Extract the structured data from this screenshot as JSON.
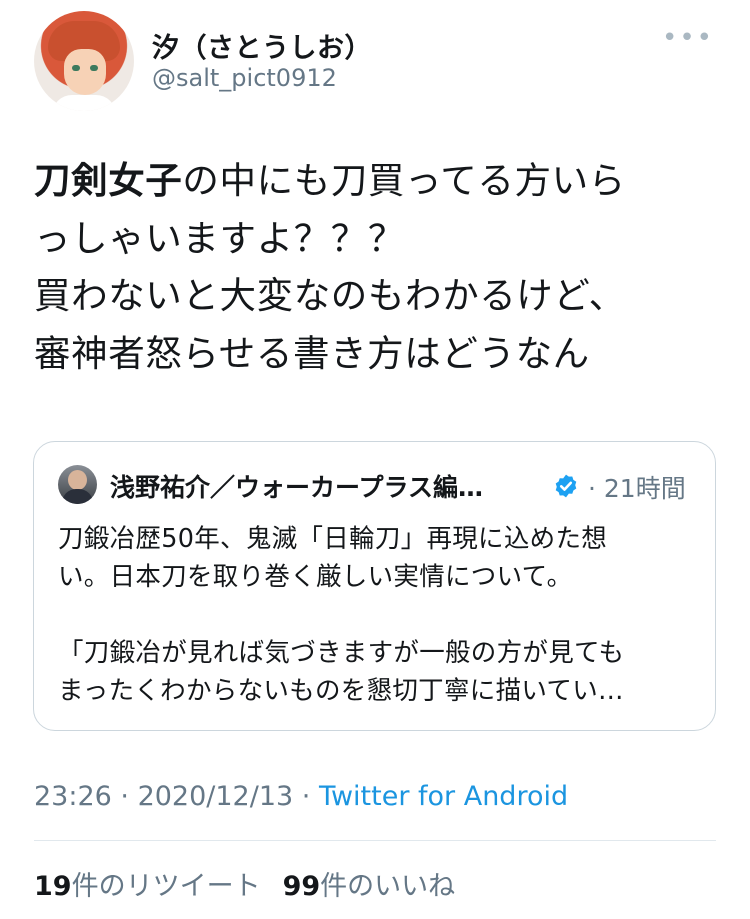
{
  "author": {
    "display_name": "汐（さとうしお）",
    "handle": "@salt_pict0912",
    "more_icon": "more-horizontal-icon"
  },
  "tweet": {
    "lines": [
      {
        "bold": "刀剣女子",
        "rest": "の中にも刀買ってる方いら"
      },
      {
        "bold": "",
        "rest": "っしゃいますよ？？？"
      },
      {
        "bold": "",
        "rest": "買わないと大変なのもわかるけど、"
      },
      {
        "bold": "",
        "rest": "審神者怒らせる書き方はどうなん"
      }
    ]
  },
  "quoted_tweet": {
    "author_name": "浅野祐介／ウォーカープラス編…",
    "verified": true,
    "time": "· 21時間",
    "lines": [
      "刀鍛冶歴50年、鬼滅「日輪刀」再現に込めた想",
      "い。日本刀を取り巻く厳しい実情について。",
      "",
      "「刀鍛冶が見れば気づきますが一般の方が見ても",
      "まったくわからないものを懇切丁寧に描いてい…"
    ]
  },
  "meta": {
    "time": "23:26",
    "separator1": " · ",
    "date": "2020/12/13",
    "separator2": " · ",
    "source": "Twitter for Android"
  },
  "stats": {
    "retweets_count": "19",
    "retweets_label": "件のリツイート",
    "likes_count": "99",
    "likes_label": "件のいいね"
  },
  "colors": {
    "text": "#14171a",
    "secondary": "#657786",
    "link": "#1b95e0",
    "verified": "#1da1f2",
    "border": "#ccd6dd"
  }
}
